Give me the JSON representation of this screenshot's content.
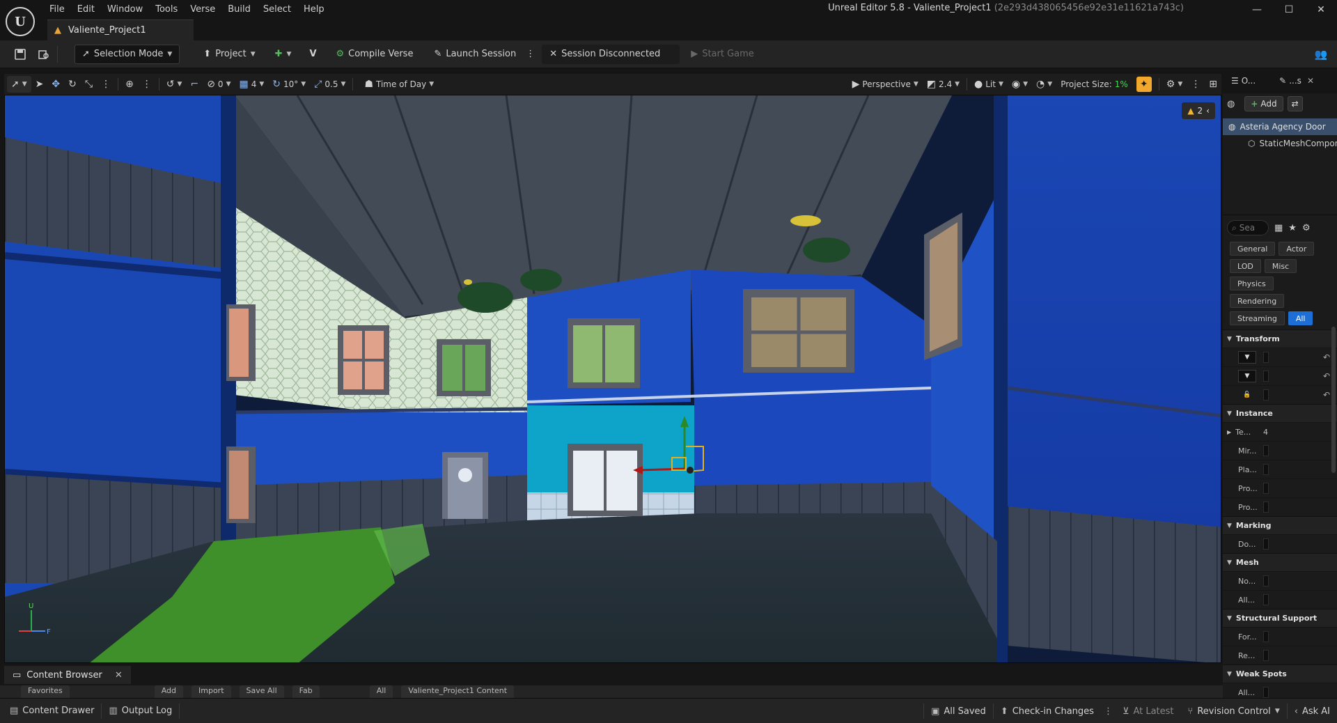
{
  "app": {
    "window_title": "Unreal Editor 5.8 - Valiente_Project1",
    "window_hash": "(2e293d438065456e92e31e11621a743c)",
    "logo_letter": "U",
    "doc_tab": "Valiente_Project1",
    "window_controls": {
      "minimize": "—",
      "maximize": "☐",
      "close": "✕"
    }
  },
  "menu": [
    "File",
    "Edit",
    "Window",
    "Tools",
    "Verse",
    "Build",
    "Select",
    "Help"
  ],
  "toolbar": {
    "selection_mode": "Selection Mode",
    "project": "Project",
    "compile_verse": "Compile Verse",
    "launch_session": "Launch Session",
    "session_status": "Session Disconnected",
    "start_game": "Start Game"
  },
  "viewport_toolbar": {
    "rotation_snap_value": "0",
    "grid_value": "4",
    "angle_value": "10°",
    "scale_value": "0.5",
    "time_of_day": "Time of Day",
    "perspective": "Perspective",
    "fov_value": "2.4",
    "lit": "Lit",
    "project_size_label": "Project Size:",
    "project_size_value": "1%"
  },
  "viewport": {
    "warning_count": "2",
    "axis_labels": {
      "up": "U",
      "right": "F"
    }
  },
  "outliner": {
    "tab1": "O...",
    "tab2": "...s",
    "add_label": "Add",
    "rows": [
      {
        "label": "Asteria Agency Door"
      },
      {
        "label": "StaticMeshComponent"
      }
    ]
  },
  "details": {
    "search_placeholder": "Sea",
    "filters": [
      "General",
      "Actor",
      "LOD",
      "Misc",
      "Physics",
      "Rendering",
      "Streaming",
      "All"
    ],
    "categories": [
      {
        "name": "Transform",
        "props": []
      },
      {
        "name": "Instance",
        "props": [
          "Te...",
          "Mir...",
          "Pla...",
          "Pro...",
          "Pro..."
        ]
      },
      {
        "name": "Marking",
        "props": [
          "Do..."
        ]
      },
      {
        "name": "Mesh",
        "props": [
          "No...",
          "All..."
        ]
      },
      {
        "name": "Structural Support",
        "props": [
          "For...",
          "Re..."
        ]
      },
      {
        "name": "Weak Spots",
        "props": [
          "All..."
        ]
      }
    ],
    "instance_first_value": "4"
  },
  "content_browser": {
    "tab_label": "Content Browser",
    "chips": [
      "Favorites",
      "Add",
      "Import",
      "Save All",
      "Fab",
      "All",
      "Valiente_Project1 Content"
    ]
  },
  "statusbar": {
    "content_drawer": "Content Drawer",
    "output_log": "Output Log",
    "all_saved": "All Saved",
    "check_in": "Check-in Changes",
    "at_latest": "At Latest",
    "revision_control": "Revision Control",
    "ask_ai": "Ask AI"
  }
}
